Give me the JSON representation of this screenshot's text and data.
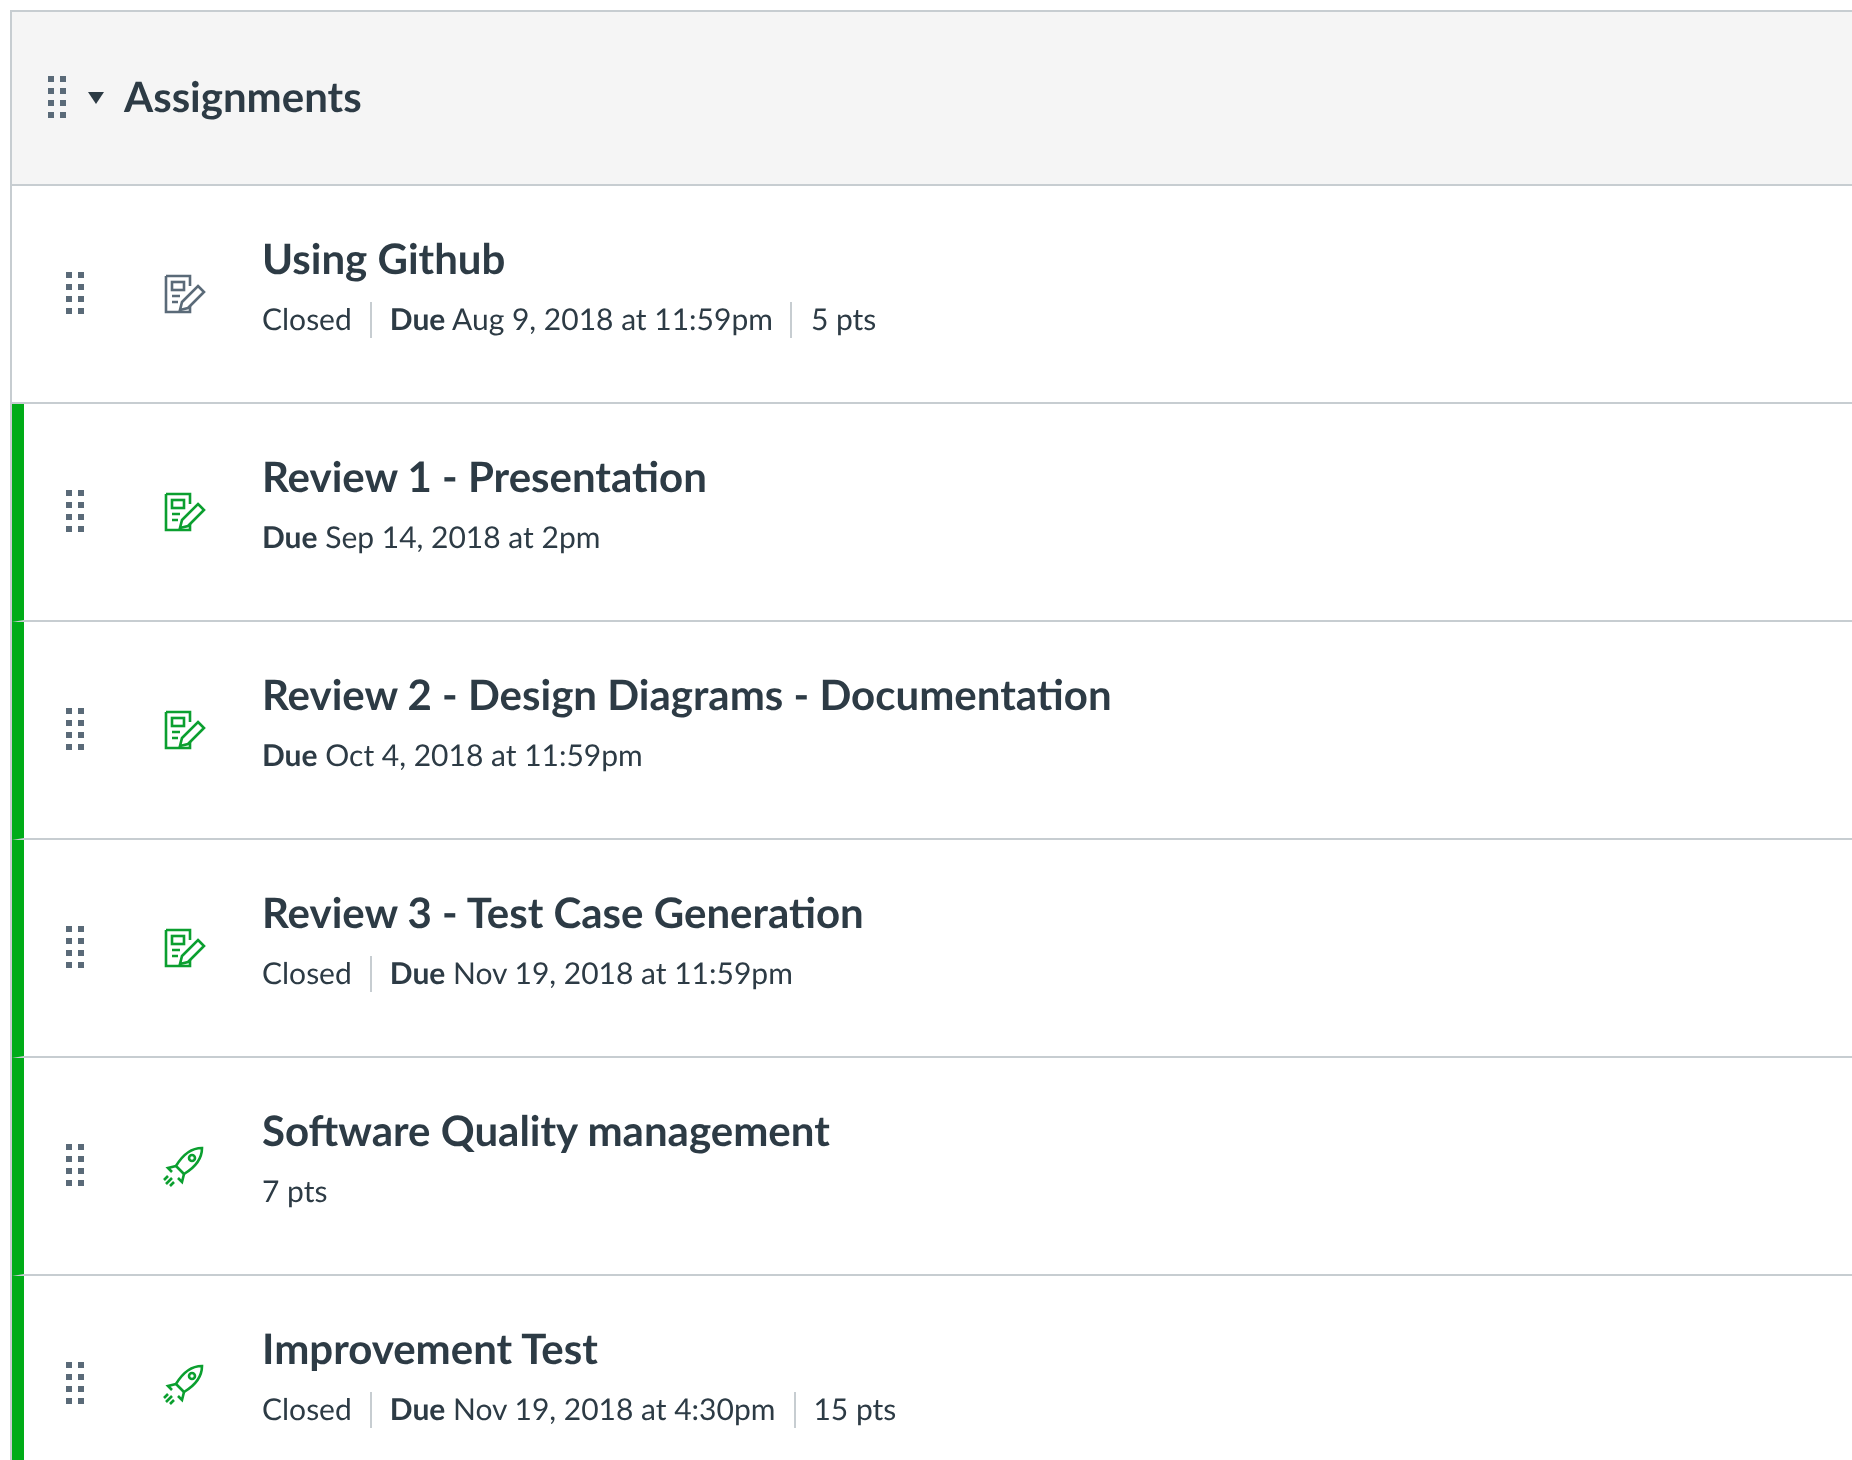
{
  "module": {
    "title": "Assignments",
    "expanded": true
  },
  "items": [
    {
      "kind": "assignment",
      "published": false,
      "title": "Using Github",
      "meta": [
        "Closed",
        "**Due** Aug 9, 2018 at 11:59pm",
        "5 pts"
      ]
    },
    {
      "kind": "assignment",
      "published": true,
      "title": "Review 1 - Presentation",
      "meta": [
        "**Due** Sep 14, 2018 at 2pm"
      ]
    },
    {
      "kind": "assignment",
      "published": true,
      "title": "Review 2 - Design Diagrams - Documentation",
      "meta": [
        "**Due** Oct 4, 2018 at 11:59pm"
      ]
    },
    {
      "kind": "assignment",
      "published": true,
      "title": "Review 3 - Test Case Generation",
      "meta": [
        "Closed",
        "**Due** Nov 19, 2018 at 11:59pm"
      ]
    },
    {
      "kind": "quiz",
      "published": true,
      "title": "Software Quality management",
      "meta": [
        "7 pts"
      ]
    },
    {
      "kind": "quiz",
      "published": true,
      "title": "Improvement Test",
      "meta": [
        "Closed",
        "**Due** Nov 19, 2018 at 4:30pm",
        "15 pts"
      ]
    }
  ]
}
